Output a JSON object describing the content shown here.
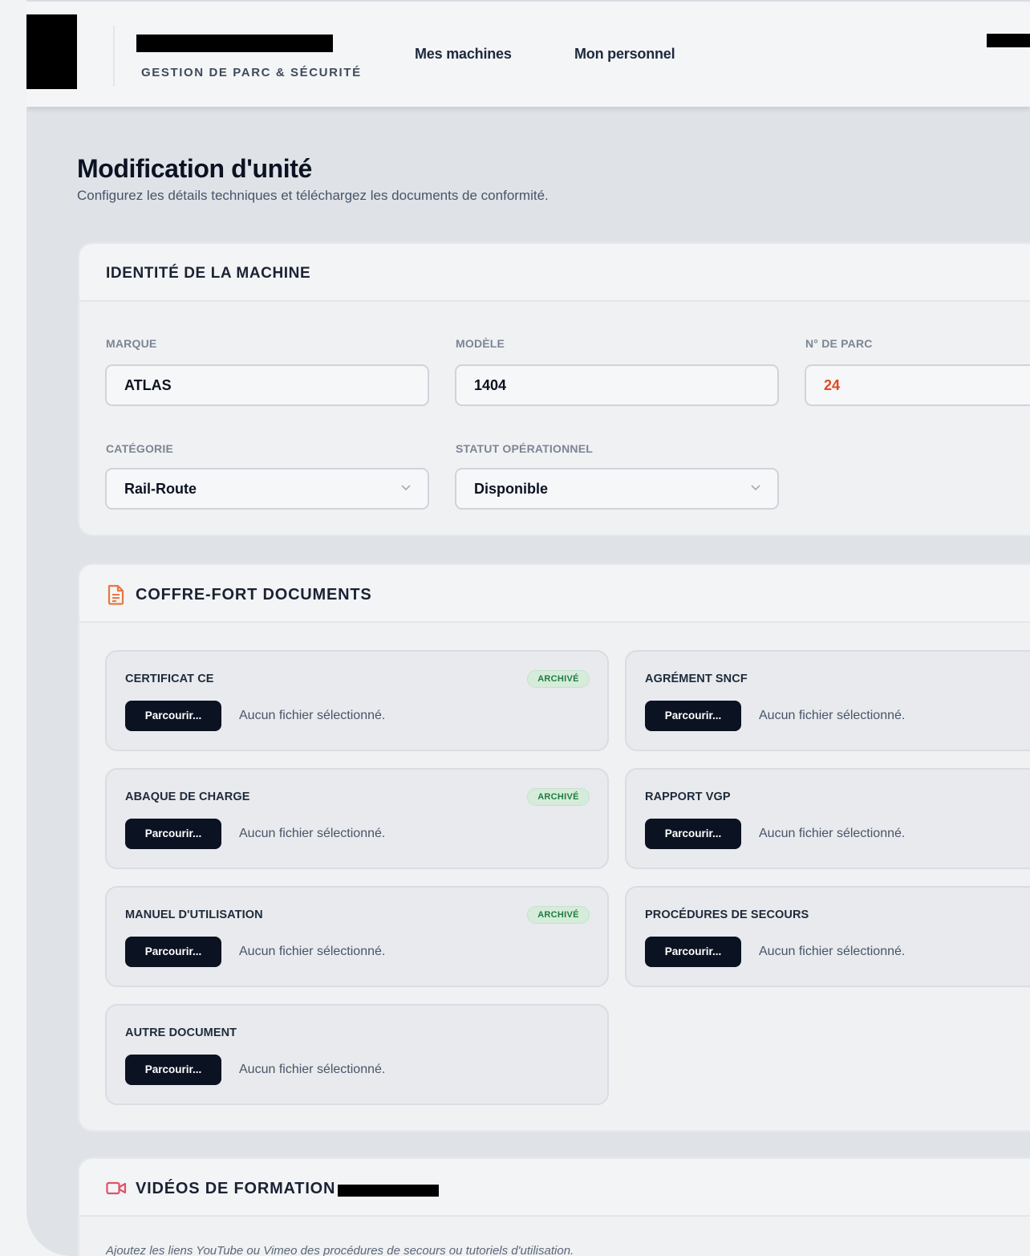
{
  "header": {
    "brand_subtitle": "GESTION DE PARC & SÉCURITÉ",
    "nav": [
      {
        "label": "Mes machines"
      },
      {
        "label": "Mon personnel"
      }
    ]
  },
  "page": {
    "title": "Modification d'unité",
    "subtitle": "Configurez les détails techniques et téléchargez les documents de conformité."
  },
  "identity": {
    "title": "IDENTITÉ DE LA MACHINE",
    "fields": {
      "brand": {
        "label": "MARQUE",
        "value": "ATLAS"
      },
      "model": {
        "label": "MODÈLE",
        "value": "1404"
      },
      "fleet_number": {
        "label": "N° DE PARC",
        "value": "24"
      },
      "category": {
        "label": "CATÉGORIE",
        "value": "Rail-Route"
      },
      "status": {
        "label": "STATUT OPÉRATIONNEL",
        "value": "Disponible"
      }
    }
  },
  "documents": {
    "title": "COFFRE-FORT DOCUMENTS",
    "browse_label": "Parcourir...",
    "no_file_text": "Aucun fichier sélectionné.",
    "archive_badge": "ARCHIVÉ",
    "items": [
      {
        "label": "CERTIFICAT CE",
        "archived": true
      },
      {
        "label": "AGRÉMENT SNCF",
        "archived": false
      },
      {
        "label": "ABAQUE DE CHARGE",
        "archived": true
      },
      {
        "label": "RAPPORT VGP",
        "archived": false
      },
      {
        "label": "MANUEL D'UTILISATION",
        "archived": true
      },
      {
        "label": "PROCÉDURES DE SECOURS",
        "archived": false
      },
      {
        "label": "AUTRE DOCUMENT",
        "archived": false
      }
    ]
  },
  "videos": {
    "title": "VIDÉOS DE FORMATION",
    "hint": "Ajoutez les liens YouTube ou Vimeo des procédures de secours ou tutoriels d'utilisation."
  },
  "colors": {
    "accent_orange": "#e04a1f",
    "primary_dark": "#0b1222",
    "badge_green": "#1f7a3f",
    "video_icon_red": "#e0526a"
  },
  "icons": {
    "documents": "file-text-icon",
    "videos": "video-camera-icon",
    "select": "chevron-down-icon"
  }
}
